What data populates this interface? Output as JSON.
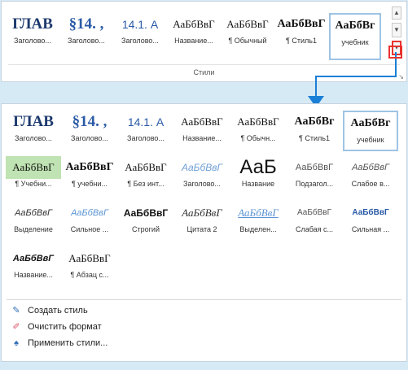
{
  "ribbon": {
    "group_label": "Стили",
    "styles": [
      {
        "preview": "ГЛАВ",
        "name": "Заголово...",
        "kind": "heading1"
      },
      {
        "preview": "§14. ,",
        "name": "Заголово...",
        "kind": "heading2"
      },
      {
        "preview": "14.1. А",
        "name": "Заголово...",
        "kind": "heading3"
      },
      {
        "preview": "АаБбВвГ",
        "name": "Название...",
        "kind": "serif"
      },
      {
        "preview": "АаБбВвГ",
        "name": "¶ Обычный",
        "kind": "serif"
      },
      {
        "preview": "АаБбВвГ",
        "name": "¶ Стиль1",
        "kind": "serif-b"
      },
      {
        "preview": "АаБбВг",
        "name": "учебник",
        "kind": "serif-b"
      }
    ],
    "scroll_up_icon": "▲",
    "scroll_down_icon": "▼",
    "more_icon": "▾"
  },
  "gallery": {
    "rows": [
      [
        {
          "preview": "ГЛАВ",
          "name": "Заголово...",
          "kind": "heading1"
        },
        {
          "preview": "§14. ,",
          "name": "Заголово...",
          "kind": "heading2"
        },
        {
          "preview": "14.1. А",
          "name": "Заголово...",
          "kind": "heading3"
        },
        {
          "preview": "АаБбВвГ",
          "name": "Название...",
          "kind": "serif"
        },
        {
          "preview": "АаБбВвГ",
          "name": "¶ Обычн...",
          "kind": "serif"
        },
        {
          "preview": "АаБбВг",
          "name": "¶ Стиль1",
          "kind": "serif-b"
        },
        {
          "preview": "АаБбВг",
          "name": "учебник",
          "kind": "serif-b"
        }
      ],
      [
        {
          "preview": "АаБбВвГ",
          "name": "¶ Учебни...",
          "kind": "green"
        },
        {
          "preview": "АаБбВвГ",
          "name": "¶ учебни...",
          "kind": "serif-b"
        },
        {
          "preview": "АаБбВвГ",
          "name": "¶ Без инт...",
          "kind": "serif"
        },
        {
          "preview": "АаБбВвГ",
          "name": "Заголово...",
          "kind": "italic-blue"
        },
        {
          "preview": "АаБ",
          "name": "Название",
          "kind": "title"
        },
        {
          "preview": "АаБбВвГ",
          "name": "Подзагол...",
          "kind": "sub"
        },
        {
          "preview": "АаБбВвГ",
          "name": "Слабое в...",
          "kind": "italic"
        }
      ],
      [
        {
          "preview": "АаБбВвГ",
          "name": "Выделение",
          "kind": "emph"
        },
        {
          "preview": "АаБбВвГ",
          "name": "Сильное ...",
          "kind": "emph-strong"
        },
        {
          "preview": "АаБбВвГ",
          "name": "Строгий",
          "kind": "strong"
        },
        {
          "preview": "АаБбВвГ",
          "name": "Цитата 2",
          "kind": "quote2"
        },
        {
          "preview": "АаБбВвГ",
          "name": "Выделен...",
          "kind": "quote-int"
        },
        {
          "preview": "АаБбВвГ",
          "name": "Слабая с...",
          "kind": "ref"
        },
        {
          "preview": "АаБбВвГ",
          "name": "Сильная ...",
          "kind": "ref-strong"
        }
      ],
      [
        {
          "preview": "АаБбВвГ",
          "name": "Название...",
          "kind": "booktitle"
        },
        {
          "preview": "АаБбВвГ",
          "name": "¶ Абзац с...",
          "kind": "serif"
        }
      ]
    ],
    "commands": [
      {
        "icon": "create-style-icon",
        "glyph": "✎",
        "label": "Создать стиль",
        "color": "#2f6fb5"
      },
      {
        "icon": "clear-formatting-icon",
        "glyph": "✐",
        "label": "Очистить формат",
        "color": "#d9566b"
      },
      {
        "icon": "apply-styles-icon",
        "glyph": "♠",
        "label": "Применить стили...",
        "color": "#2f6fb5"
      }
    ]
  },
  "colors": {
    "background": "#d6eaf6",
    "arrow": "#1a7fd6",
    "highlight": "#e8332f"
  }
}
